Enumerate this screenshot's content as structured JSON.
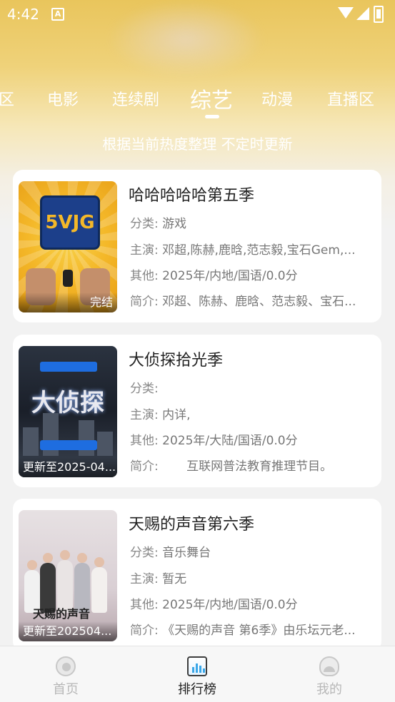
{
  "status_bar": {
    "time": "4:42",
    "notification_icon": "A"
  },
  "tabs": [
    "区",
    "电影",
    "连续剧",
    "综艺",
    "动漫",
    "直播区"
  ],
  "active_tab_index": 3,
  "subtitle": "根据当前热度整理 不定时更新",
  "cards": [
    {
      "title": "哈哈哈哈哈第五季",
      "badge": "完结",
      "category_label": "分类:",
      "category": "游戏",
      "cast_label": "主演:",
      "cast": "邓超,陈赫,鹿晗,范志毅,宝石Gem,...",
      "other_label": "其他:",
      "other": "2025年/内地/国语/0.0分",
      "intro_label": "简介:",
      "intro": "邓超、陈赫、鹿晗、范志毅、宝石...",
      "poster_text": "5VJG"
    },
    {
      "title": "大侦探拾光季",
      "badge": "更新至2025-04...",
      "category_label": "分类:",
      "category": "",
      "cast_label": "主演:",
      "cast": "内详,",
      "other_label": "其他:",
      "other": "2025年/大陆/国语/0.0分",
      "intro_label": "简介:",
      "intro": "　　互联网普法教育推理节目。",
      "poster_text": "大侦探"
    },
    {
      "title": "天赐的声音第六季",
      "badge": "更新至202504...",
      "category_label": "分类:",
      "category": "音乐舞台",
      "cast_label": "主演:",
      "cast": "暂无",
      "other_label": "其他:",
      "other": "2025年/内地/国语/0.0分",
      "intro_label": "简介:",
      "intro": "《天赐的声音 第6季》由乐坛元老...",
      "poster_text": "天赐的声音"
    }
  ],
  "bottom_nav": [
    {
      "label": "首页",
      "icon": "home-icon",
      "active": false
    },
    {
      "label": "排行榜",
      "icon": "ranking-icon",
      "active": true
    },
    {
      "label": "我的",
      "icon": "profile-icon",
      "active": false
    }
  ],
  "colors": {
    "accent_gold": "#e9c55c",
    "nav_active": "#222222",
    "nav_inactive": "#b8b8b8"
  }
}
